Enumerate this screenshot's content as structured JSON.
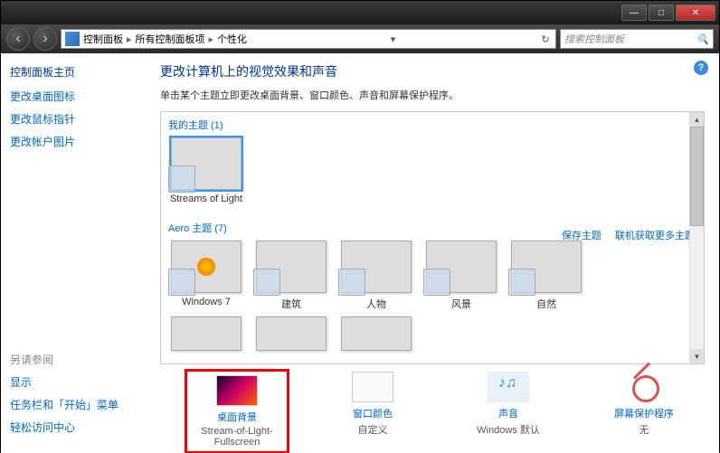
{
  "titlebar": {
    "min": "—",
    "max": "□",
    "close": "✕"
  },
  "nav": {
    "back": "‹",
    "forward": "›",
    "crumb1": "控制面板",
    "crumb2": "所有控制面板项",
    "crumb3": "个性化",
    "sep": "▸",
    "dropdown": "▾",
    "refresh": "↻"
  },
  "search": {
    "placeholder": "搜索控制面板",
    "icon": "🔍"
  },
  "sidebar": {
    "head": "控制面板主页",
    "links": [
      "更改桌面图标",
      "更改鼠标指针",
      "更改帐户图片"
    ],
    "alt_head": "另请参阅",
    "alt_links": [
      "显示",
      "任务栏和「开始」菜单",
      "轻松访问中心"
    ]
  },
  "main": {
    "help": "?",
    "title": "更改计算机上的视觉效果和声音",
    "subtitle": "单击某个主题立即更改桌面背景、窗口颜色、声音和屏幕保护程序。",
    "group_my": "我的主题 (1)",
    "theme_streams": "Streams of Light",
    "group_aero": "Aero 主题 (7)",
    "aero": [
      "Windows 7",
      "建筑",
      "人物",
      "风景",
      "自然"
    ],
    "link_save": "保存主题",
    "link_more": "联机获取更多主题",
    "scroll_up": "▲",
    "scroll_down": "▼"
  },
  "bottom": {
    "bg": {
      "label": "桌面背景",
      "sub": "Stream-of-Light-Fullscreen"
    },
    "color": {
      "label": "窗口颜色",
      "sub": "自定义"
    },
    "sound": {
      "label": "声音",
      "sub": "Windows 默认"
    },
    "saver": {
      "label": "屏幕保护程序",
      "sub": "无"
    }
  }
}
